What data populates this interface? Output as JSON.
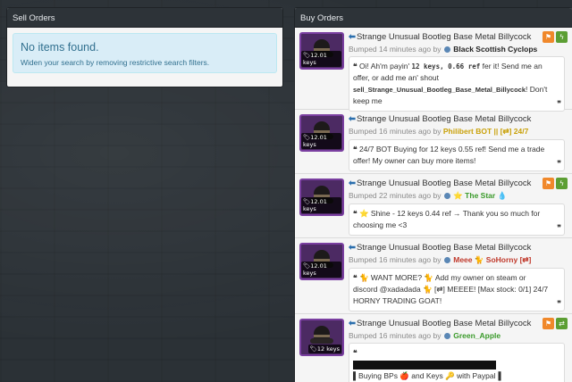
{
  "sell_orders": {
    "title": "Sell Orders",
    "empty_title": "No items found.",
    "empty_hint": "Widen your search by removing restrictive search filters."
  },
  "buy_orders": {
    "title": "Buy Orders",
    "listings": [
      {
        "item_name": "Strange Unusual Bootleg Base Metal Billycock",
        "price_tag": "12.01 keys",
        "bumped": "Bumped 14 minutes ago by",
        "user": "Black Scottish Cyclops",
        "user_color": "#222222",
        "message_pre": "Oi! Ah'm payin' ",
        "message_bold1": "12 keys, 0.66 ref",
        "message_mid": " fer it! Send me an offer, or add me an' shout ",
        "message_bold2": "sell_Strange_Unusual_Bootleg_Base_Metal_Billycock",
        "message_post": "! Don't keep me",
        "action": "bolt"
      },
      {
        "item_name": "Strange Unusual Bootleg Base Metal Billycock",
        "price_tag": "12.01 keys",
        "bumped": "Bumped 16 minutes ago by",
        "user": "Philibert BOT || [⇄] 24/7",
        "user_color": "#c9a10a",
        "message": "24/7 BOT Buying for 12 keys 0.55 ref! Send me a trade offer! My owner can buy more items!",
        "action": "bolt"
      },
      {
        "item_name": "Strange Unusual Bootleg Base Metal Billycock",
        "price_tag": "12.01 keys",
        "bumped": "Bumped 22 minutes ago by",
        "user": "⭐ The Star 💧",
        "user_color": "#3a9a2a",
        "message": "⭐ Shine - 12 keys 0.44 ref → Thank you so much for choosing me <3",
        "action": "bolt"
      },
      {
        "item_name": "Strange Unusual Bootleg Base Metal Billycock",
        "price_tag": "12.01 keys",
        "bumped": "Bumped 16 minutes ago by",
        "user": "Meee 🐈 SoHorny [⇄]",
        "user_color": "#c0392b",
        "message": "🐈 WANT MORE? 🐈 Add my owner on steam or discord @xadadada 🐈 [⇄] MEEEE! [Max stock: 0/1] 24/7 HORNY TRADING GOAT!",
        "action": "bolt"
      },
      {
        "item_name": "Strange Unusual Bootleg Base Metal Billycock",
        "price_tag": "12 keys",
        "bumped": "Bumped 16 minutes ago by",
        "user": "Green_Apple",
        "user_color": "#3a9a2a",
        "message": "▌Buying BPs 🍎 and Keys 🔑 with Paypal▐",
        "action": "swap"
      }
    ]
  },
  "icons": {
    "flag": "flag-icon",
    "bolt": "lightning-icon",
    "swap": "swap-icon",
    "back_arrow": "arrow-left-icon"
  }
}
